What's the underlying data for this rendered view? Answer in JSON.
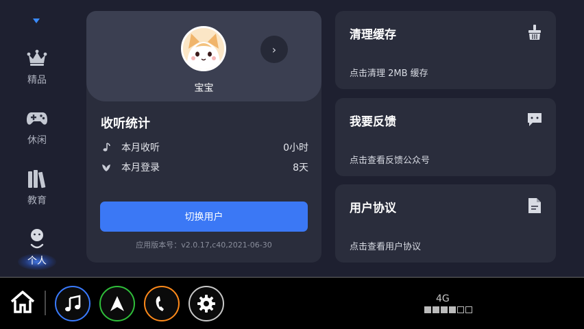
{
  "sidebar": {
    "items": [
      {
        "label": "精品",
        "icon": "crown-icon",
        "active": false
      },
      {
        "label": "休闲",
        "icon": "gamepad-icon",
        "active": false
      },
      {
        "label": "教育",
        "icon": "books-icon",
        "active": false
      },
      {
        "label": "个人",
        "icon": "person-icon",
        "active": true
      }
    ]
  },
  "profile": {
    "username": "宝宝",
    "stats_title": "收听统计",
    "stats": [
      {
        "label": "本月收听",
        "value": "0小时",
        "icon": "music-note-icon"
      },
      {
        "label": "本月登录",
        "value": "8天",
        "icon": "leaf-icon"
      }
    ],
    "switch_user_label": "切换用户",
    "version": "应用版本号：v2.0.17,c40,2021-06-30"
  },
  "cards": [
    {
      "title": "清理缓存",
      "desc": "点击清理  2MB 缓存",
      "icon": "broom-icon"
    },
    {
      "title": "我要反馈",
      "desc": "点击查看反馈公众号",
      "icon": "chat-icon"
    },
    {
      "title": "用户协议",
      "desc": "点击查看用户协议",
      "icon": "document-icon"
    }
  ],
  "dock": {
    "apps": [
      {
        "icon": "music-icon",
        "color": "#3a7bff"
      },
      {
        "icon": "navigation-icon",
        "color": "#2fbf3a"
      },
      {
        "icon": "phone-icon",
        "color": "#ff8a1a"
      },
      {
        "icon": "settings-icon",
        "color": "#c9c9c9"
      }
    ],
    "network": "4G",
    "signal_level": 4,
    "signal_max": 6
  },
  "colors": {
    "background": "#1e2030",
    "card": "#2a2d3c",
    "accent": "#3b78f5"
  }
}
